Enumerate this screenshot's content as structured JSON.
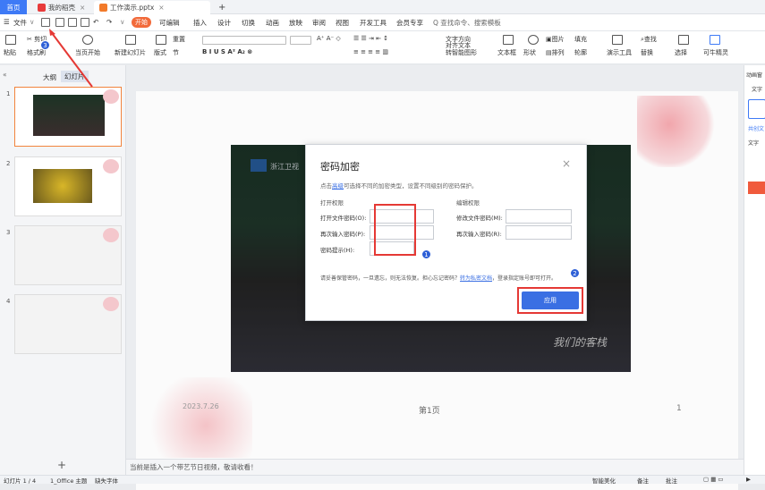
{
  "tabs": {
    "home": "首页",
    "tab1": "我的稻壳",
    "tab2": "工作演示.pptx",
    "new_tab": "+"
  },
  "menu": {
    "file": "文件",
    "start_btn": "开始",
    "items": [
      "插入",
      "设计",
      "切换",
      "动画",
      "放映",
      "审阅",
      "视图",
      "开发工具",
      "会员专享"
    ],
    "insert_label": "可编辑",
    "search": "Q 查找命令、搜索模板"
  },
  "ribbon": {
    "paste": "粘贴",
    "cut": "剪切",
    "format_painter": "格式刷",
    "from_current": "当页开始",
    "new_slide": "新建幻灯片",
    "layout": "版式",
    "section": "节",
    "reset": "重置",
    "textbox": "文本框",
    "shape": "形状",
    "arrange": "排列",
    "find": "查找",
    "replace": "替换",
    "select": "选择",
    "tools": "演示工具",
    "assist": "可牛精灵",
    "picture": "图片",
    "fill": "填充",
    "outline": "轮廓",
    "textpos": "文字方向",
    "align": "对齐文本",
    "convert": "转智能图形"
  },
  "left_pane": {
    "tab_outline": "大纲",
    "tab_slides": "幻灯片",
    "slide_numbers": [
      "1",
      "2",
      "3",
      "4"
    ],
    "add": "+"
  },
  "slide": {
    "date": "2023.7.26",
    "page": "第1页",
    "page_number": "1",
    "logo_text": "浙江卫视",
    "watermark": "我们的客栈"
  },
  "dialog": {
    "title": "密码加密",
    "desc_prefix": "点击",
    "desc_link": "高级",
    "desc_suffix": "可选择不同的加密类型，设置不同级别的密码保护。",
    "open_section": "打开权限",
    "edit_section": "编辑权限",
    "open_pwd": "打开文件密码(O):",
    "open_pwd_confirm": "再次输入密码(P):",
    "pwd_hint": "密码提示(H):",
    "edit_pwd": "修改文件密码(M):",
    "edit_pwd_confirm": "再次输入密码(R):",
    "notice": "请妥善保管密码，一旦遗忘，则无法恢复。担心忘记密码？",
    "notice_link": "转为私密文档",
    "notice_suffix": "，登录指定账号即可打开。",
    "apply": "应用",
    "close": "×"
  },
  "badges": {
    "b1": "1",
    "b2": "2",
    "b3": "3"
  },
  "notes": {
    "placeholder": "当前是插入一个带艺节日视频，敬请收看！"
  },
  "status": {
    "slide_info": "幻灯片 1 / 4",
    "theme": "1_Office 主题",
    "font_missing": "缺失字体",
    "smart": "智能美化",
    "notes": "备注",
    "comment": "批注"
  },
  "right_pane": {
    "label1": "动画窗",
    "label2": "文字",
    "label3": "文字",
    "label4": "共创文"
  },
  "colors": {
    "accent": "#3e7af6",
    "start": "#f26a3a",
    "highlight": "#e53935",
    "apply": "#3a6fe3"
  }
}
